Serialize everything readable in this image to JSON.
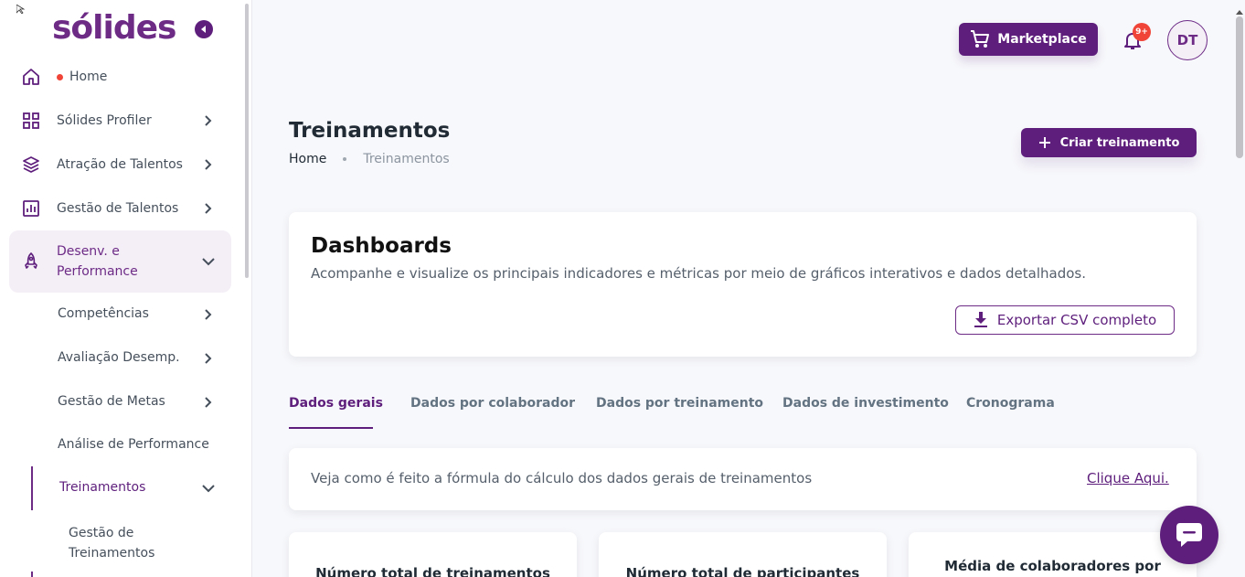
{
  "brand": {
    "logo_text": "sólides",
    "accent": "#5e1f7c"
  },
  "sidebar": {
    "items": [
      {
        "label": "Home",
        "icon": "home-icon",
        "status_dot": true
      },
      {
        "label": "Sólides Profiler",
        "icon": "grid-icon"
      },
      {
        "label": "Atração de Talentos",
        "icon": "layers-icon"
      },
      {
        "label": "Gestão de Talentos",
        "icon": "chart-icon"
      },
      {
        "label_line1": "Desenv. e",
        "label_line2": "Performance",
        "icon": "rocket-icon",
        "expanded": true
      }
    ],
    "sub_items": [
      {
        "label": "Competências"
      },
      {
        "label": "Avaliação Desemp."
      },
      {
        "label": "Gestão de Metas"
      },
      {
        "label": "Análise de Performance"
      },
      {
        "label": "Treinamentos",
        "active": true
      },
      {
        "label_line1": "Gestão de",
        "label_line2": "Treinamentos"
      }
    ]
  },
  "header": {
    "marketplace_label": "Marketplace",
    "notifications_badge": "9+",
    "avatar_initials": "DT"
  },
  "page": {
    "title": "Treinamentos",
    "breadcrumb_home": "Home",
    "breadcrumb_current": "Treinamentos",
    "create_button": "Criar treinamento"
  },
  "dashboard": {
    "title": "Dashboards",
    "subtitle": "Acompanhe e visualize os principais indicadores e métricas por meio de gráficos interativos e dados detalhados.",
    "export_button": "Exportar CSV completo"
  },
  "tabs": [
    {
      "label": "Dados gerais",
      "active": true
    },
    {
      "label": "Dados por colaborador"
    },
    {
      "label": "Dados por treinamento"
    },
    {
      "label": "Dados de investimento"
    },
    {
      "label": "Cronograma"
    }
  ],
  "formula": {
    "text": "Veja como é feito a fórmula do cálculo dos dados gerais de treinamentos",
    "link": "Clique Aqui."
  },
  "metrics": [
    {
      "label": "Número total de treinamentos"
    },
    {
      "label": "Número total de participantes"
    },
    {
      "label": "Média de colaboradores por"
    }
  ]
}
